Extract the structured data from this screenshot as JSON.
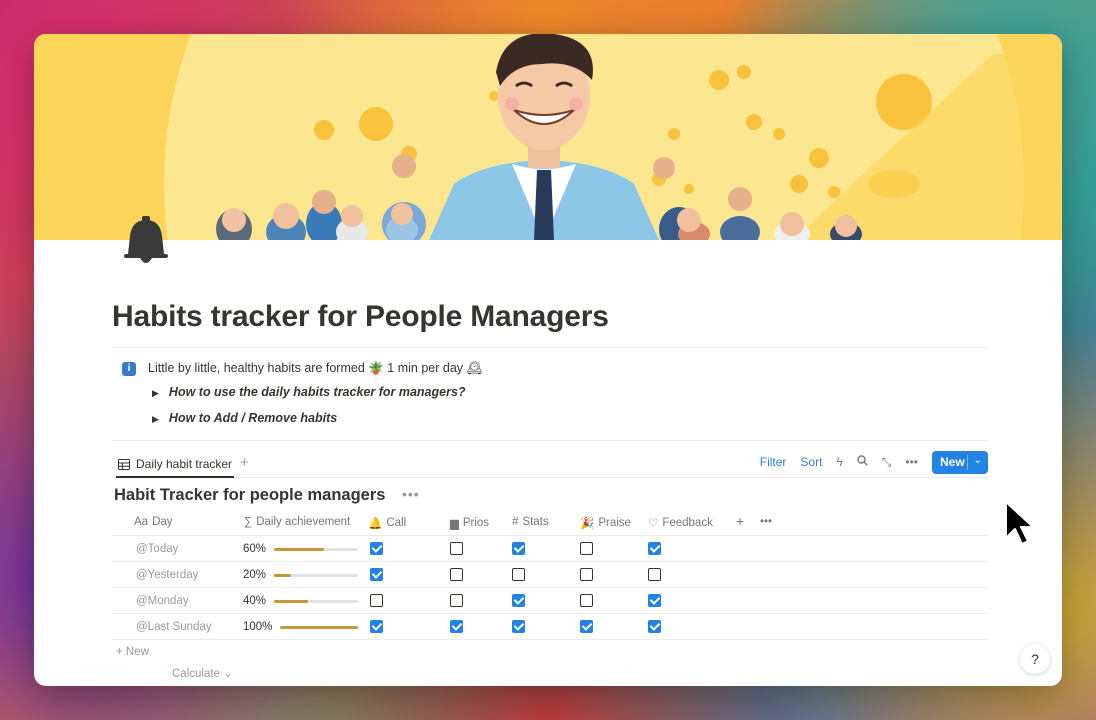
{
  "page": {
    "title": "Habits tracker for People Managers",
    "callout": {
      "text": "Little by little, healthy habits are formed 🪴 1 min per day 🕰",
      "icon_label": "i",
      "toggles": [
        "How to use the daily habits tracker for managers?",
        "How to Add / Remove habits"
      ]
    }
  },
  "view": {
    "tab_label": "Daily habit tracker",
    "filter": "Filter",
    "sort": "Sort",
    "new_button": "New",
    "toolbar_icons": [
      "lightning-icon",
      "search-icon",
      "expand-icon",
      "more-icon"
    ]
  },
  "database": {
    "title": "Habit Tracker for people managers",
    "columns": {
      "day": "Day",
      "day_prefix": "Aa",
      "achievement": "Daily achievement",
      "call": "Call",
      "prios": "Prios",
      "stats": "Stats",
      "praise": "Praise",
      "feedback": "Feedback"
    },
    "rows": [
      {
        "day": "@Today",
        "pct": "60%",
        "value": 0.6,
        "call": true,
        "prios": false,
        "stats": true,
        "praise": false,
        "feedback": true
      },
      {
        "day": "@Yesterday",
        "pct": "20%",
        "value": 0.2,
        "call": true,
        "prios": false,
        "stats": false,
        "praise": false,
        "feedback": false
      },
      {
        "day": "@Monday",
        "pct": "40%",
        "value": 0.4,
        "call": false,
        "prios": false,
        "stats": true,
        "praise": false,
        "feedback": true
      },
      {
        "day": "@Last Sunday",
        "pct": "100%",
        "value": 1.0,
        "call": true,
        "prios": true,
        "stats": true,
        "praise": true,
        "feedback": true
      }
    ],
    "add_row": "+ New",
    "calculate": "Calculate ⌄"
  },
  "help": "?",
  "colors": {
    "accent": "#2383e2",
    "progress": "#c8973a",
    "cover": "#fbd55a"
  }
}
